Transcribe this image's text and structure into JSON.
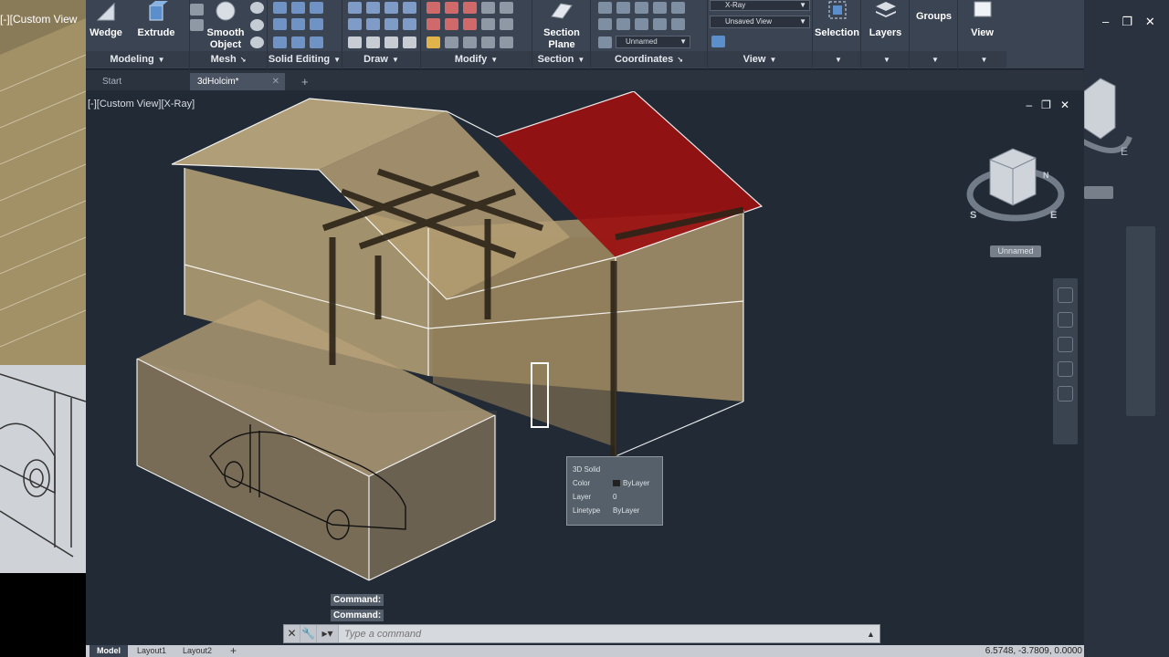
{
  "left_window": {
    "viewport_label": "[-][Custom View"
  },
  "ribbon": {
    "modeling": {
      "title": "Modeling",
      "wedge": "Wedge",
      "extrude": "Extrude"
    },
    "mesh": {
      "title": "Mesh",
      "smooth_object": "Smooth Object"
    },
    "solid_editing": {
      "title": "Solid Editing"
    },
    "draw": {
      "title": "Draw"
    },
    "modify": {
      "title": "Modify"
    },
    "section": {
      "title": "Section",
      "section_plane": "Section Plane"
    },
    "coordinates": {
      "title": "Coordinates",
      "ucs_value": "Unnamed"
    },
    "view": {
      "title": "View",
      "visual_style": "X-Ray",
      "named_view": "Unsaved View"
    },
    "selection": {
      "label": "Selection"
    },
    "layers": {
      "label": "Layers"
    },
    "groups": {
      "label": "Groups"
    },
    "view_btn": {
      "label": "View"
    }
  },
  "tabs": [
    {
      "label": "Start"
    },
    {
      "label": "3dHolcim*"
    }
  ],
  "viewport": {
    "label": "[-][Custom View][X-Ray]",
    "viewcube_label": "Unnamed",
    "compass": {
      "n": "N",
      "s": "S",
      "e": "E"
    }
  },
  "tooltip": {
    "title": "3D Solid",
    "color_label": "Color",
    "color_value": "ByLayer",
    "layer_label": "Layer",
    "layer_value": "0",
    "linetype_label": "Linetype",
    "linetype_value": "ByLayer"
  },
  "command": {
    "history": [
      "Command:",
      "Command:"
    ],
    "placeholder": "Type a command"
  },
  "statusbar": {
    "tabs": [
      "Model",
      "Layout1",
      "Layout2"
    ],
    "coords": "6.5748, -3.7809, 0.0000"
  },
  "colors": {
    "ribbon_bg": "#3b4453",
    "viewport_bg": "#212a35",
    "roof_red": "#9b1010",
    "wall_tan": "#b9a377"
  }
}
